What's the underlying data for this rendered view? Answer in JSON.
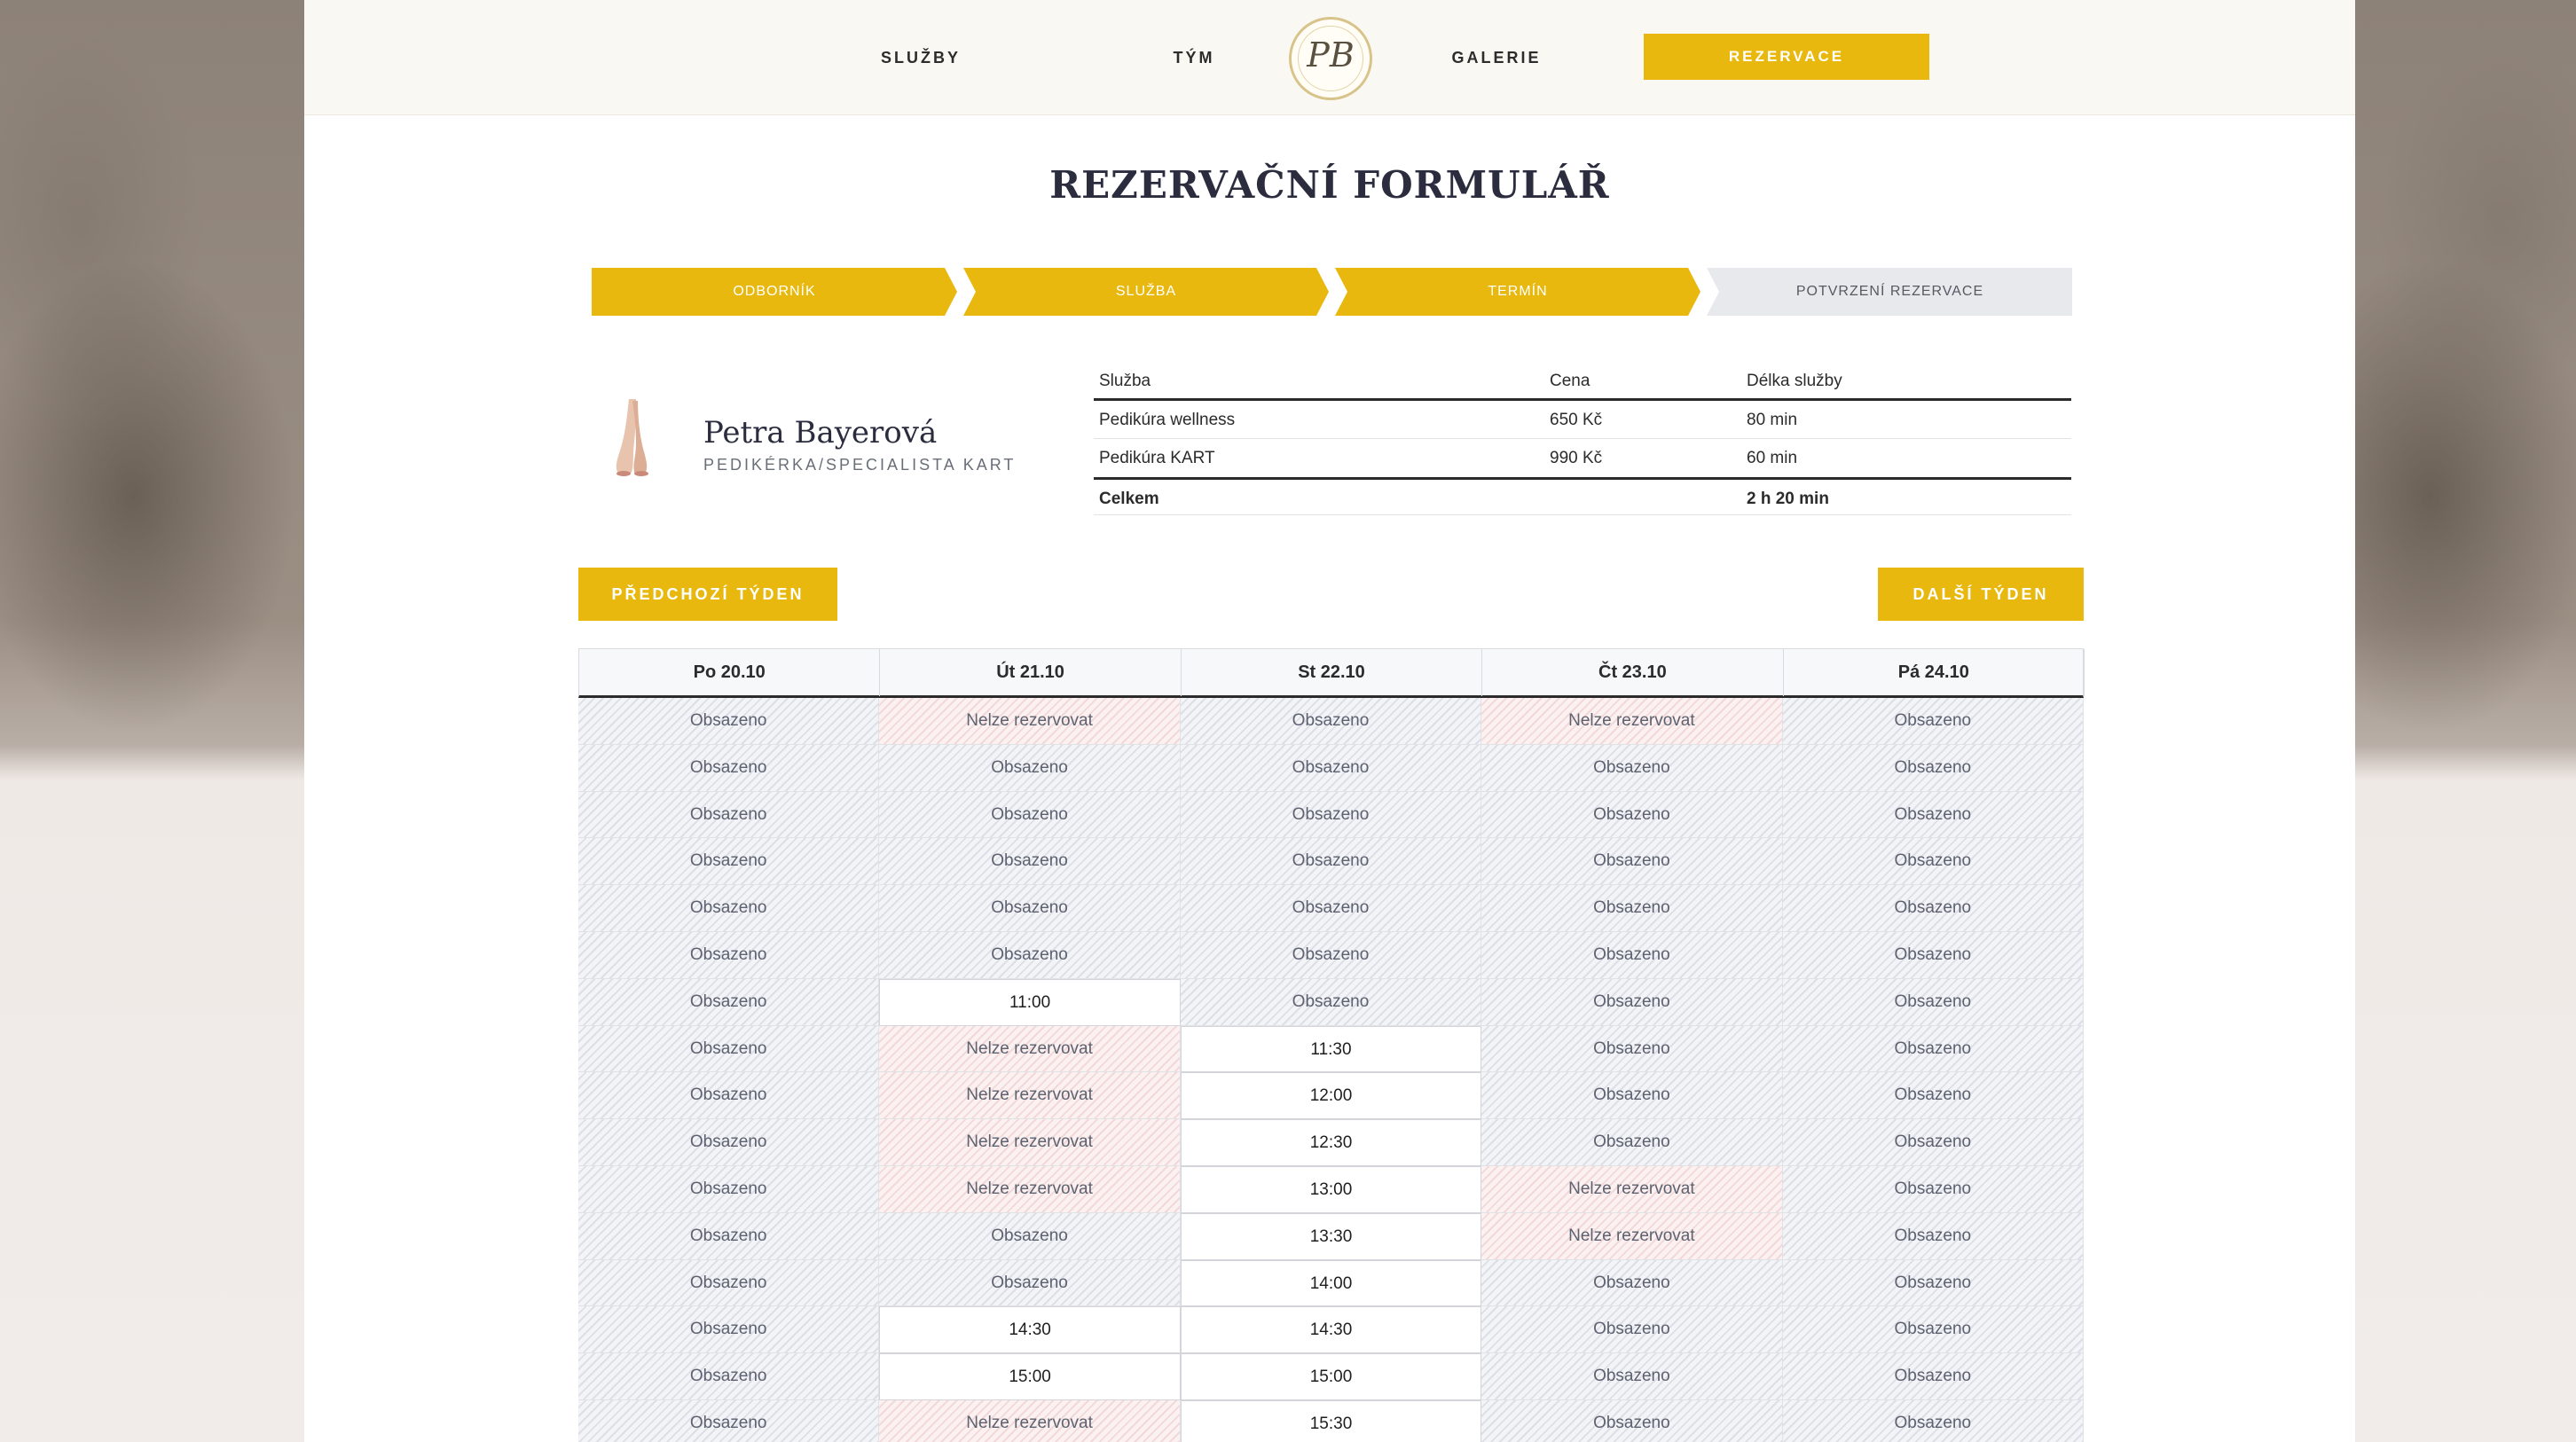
{
  "nav": {
    "links": [
      "SLUŽBY",
      "TÝM",
      "GALERIE"
    ],
    "logo": "PB",
    "cta": "REZERVACE"
  },
  "heading": "REZERVAČNÍ FORMULÁŘ",
  "steps": [
    {
      "label": "ODBORNÍK",
      "active": true
    },
    {
      "label": "SLUŽBA",
      "active": true
    },
    {
      "label": "TERMÍN",
      "active": true
    },
    {
      "label": "POTVRZENÍ REZERVACE",
      "active": false
    }
  ],
  "specialist": {
    "name": "Petra Bayerová",
    "role": "PEDIKÉRKA/SPECIALISTA KART"
  },
  "services": {
    "headers": [
      "Služba",
      "Cena",
      "Délka služby"
    ],
    "rows": [
      [
        "Pedikúra wellness",
        "650 Kč",
        "80 min"
      ],
      [
        "Pedikúra KART",
        "990 Kč",
        "60 min"
      ]
    ],
    "total": {
      "label": "Celkem",
      "price": "",
      "duration": "2 h 20 min"
    }
  },
  "week_nav": {
    "prev": "PŘEDCHOZÍ TÝDEN",
    "next": "DALŠÍ TÝDEN"
  },
  "calendar": {
    "days": [
      "Po 20.10",
      "Út 21.10",
      "St 22.10",
      "Čt 23.10",
      "Pá 24.10"
    ],
    "rows": [
      [
        "Obsazeno",
        "Nelze rezervovat",
        "Obsazeno",
        "Nelze rezervovat",
        "Obsazeno"
      ],
      [
        "Obsazeno",
        "Obsazeno",
        "Obsazeno",
        "Obsazeno",
        "Obsazeno"
      ],
      [
        "Obsazeno",
        "Obsazeno",
        "Obsazeno",
        "Obsazeno",
        "Obsazeno"
      ],
      [
        "Obsazeno",
        "Obsazeno",
        "Obsazeno",
        "Obsazeno",
        "Obsazeno"
      ],
      [
        "Obsazeno",
        "Obsazeno",
        "Obsazeno",
        "Obsazeno",
        "Obsazeno"
      ],
      [
        "Obsazeno",
        "Obsazeno",
        "Obsazeno",
        "Obsazeno",
        "Obsazeno"
      ],
      [
        "Obsazeno",
        "11:00",
        "Obsazeno",
        "Obsazeno",
        "Obsazeno"
      ],
      [
        "Obsazeno",
        "Nelze rezervovat",
        "11:30",
        "Obsazeno",
        "Obsazeno"
      ],
      [
        "Obsazeno",
        "Nelze rezervovat",
        "12:00",
        "Obsazeno",
        "Obsazeno"
      ],
      [
        "Obsazeno",
        "Nelze rezervovat",
        "12:30",
        "Obsazeno",
        "Obsazeno"
      ],
      [
        "Obsazeno",
        "Nelze rezervovat",
        "13:00",
        "Nelze rezervovat",
        "Obsazeno"
      ],
      [
        "Obsazeno",
        "Obsazeno",
        "13:30",
        "Nelze rezervovat",
        "Obsazeno"
      ],
      [
        "Obsazeno",
        "Obsazeno",
        "14:00",
        "Obsazeno",
        "Obsazeno"
      ],
      [
        "Obsazeno",
        "14:30",
        "14:30",
        "Obsazeno",
        "Obsazeno"
      ],
      [
        "Obsazeno",
        "15:00",
        "15:00",
        "Obsazeno",
        "Obsazeno"
      ],
      [
        "Obsazeno",
        "Nelze rezervovat",
        "15:30",
        "Obsazeno",
        "Obsazeno"
      ]
    ]
  },
  "colors": {
    "accent": "#e9b80e",
    "text_dark": "#2b2d3f",
    "step_inactive": "#e8e9ec"
  }
}
